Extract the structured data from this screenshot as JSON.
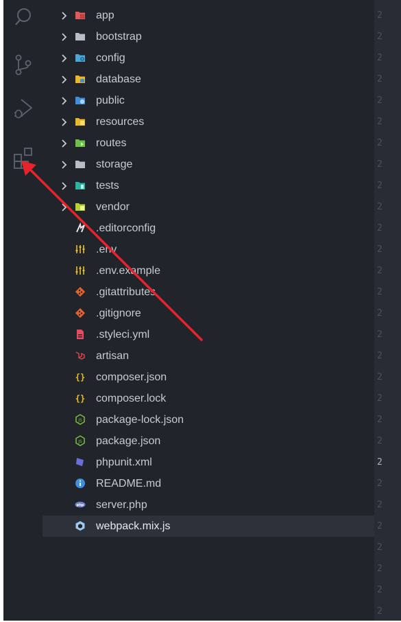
{
  "explorer": {
    "items": [
      {
        "label": "app",
        "type": "folder",
        "icon": "app-folder-icon",
        "color": "#e05a5a"
      },
      {
        "label": "bootstrap",
        "type": "folder",
        "icon": "folder-icon",
        "color": "#b8bcc4"
      },
      {
        "label": "config",
        "type": "folder",
        "icon": "config-folder-icon",
        "color": "#4aa7d8"
      },
      {
        "label": "database",
        "type": "folder",
        "icon": "database-folder-icon",
        "color": "#e9b824"
      },
      {
        "label": "public",
        "type": "folder",
        "icon": "public-folder-icon",
        "color": "#3f8fdc"
      },
      {
        "label": "resources",
        "type": "folder",
        "icon": "resources-folder-icon",
        "color": "#e9b824"
      },
      {
        "label": "routes",
        "type": "folder",
        "icon": "routes-folder-icon",
        "color": "#6cc04a"
      },
      {
        "label": "storage",
        "type": "folder",
        "icon": "folder-icon",
        "color": "#b8bcc4"
      },
      {
        "label": "tests",
        "type": "folder",
        "icon": "tests-folder-icon",
        "color": "#2bb5a0"
      },
      {
        "label": "vendor",
        "type": "folder",
        "icon": "vendor-folder-icon",
        "color": "#b7d130"
      },
      {
        "label": ".editorconfig",
        "type": "file",
        "icon": "editorconfig-icon",
        "color": "#e8e8e8"
      },
      {
        "label": ".env",
        "type": "file",
        "icon": "env-settings-icon",
        "color": "#e8c02a"
      },
      {
        "label": ".env.example",
        "type": "file",
        "icon": "env-settings-icon",
        "color": "#e8c02a"
      },
      {
        "label": ".gitattributes",
        "type": "file",
        "icon": "git-icon",
        "color": "#e4622c"
      },
      {
        "label": ".gitignore",
        "type": "file",
        "icon": "git-icon",
        "color": "#e4622c"
      },
      {
        "label": ".styleci.yml",
        "type": "file",
        "icon": "yaml-file-icon",
        "color": "#e34c60"
      },
      {
        "label": "artisan",
        "type": "file",
        "icon": "laravel-icon",
        "color": "#e3484a"
      },
      {
        "label": "composer.json",
        "type": "file",
        "icon": "json-braces-icon",
        "color": "#e8c02a"
      },
      {
        "label": "composer.lock",
        "type": "file",
        "icon": "json-braces-icon",
        "color": "#e8c02a"
      },
      {
        "label": "package-lock.json",
        "type": "file",
        "icon": "nodejs-icon",
        "color": "#7bbf3e"
      },
      {
        "label": "package.json",
        "type": "file",
        "icon": "nodejs-icon",
        "color": "#7bbf3e"
      },
      {
        "label": "phpunit.xml",
        "type": "file",
        "icon": "phpunit-icon",
        "color": "#6a6fd8"
      },
      {
        "label": "README.md",
        "type": "file",
        "icon": "info-icon",
        "color": "#3f8fdc"
      },
      {
        "label": "server.php",
        "type": "file",
        "icon": "php-icon",
        "color": "#6a7fd4"
      },
      {
        "label": "webpack.mix.js",
        "type": "file",
        "icon": "webpack-cube-icon",
        "color": "#9fc8ee",
        "selected": true
      }
    ]
  },
  "activity_bar": {
    "icons": [
      "search-icon",
      "source-control-icon",
      "run-debug-icon",
      "extensions-icon"
    ]
  },
  "editor": {
    "line_numbers": [
      "2",
      "2",
      "2",
      "2",
      "2",
      "2",
      "2",
      "2",
      "2",
      "2",
      "2",
      "2",
      "2",
      "2",
      "2",
      "2",
      "2",
      "2",
      "2",
      "2",
      "2",
      "2",
      "2",
      "2",
      "2",
      "2",
      "2",
      "2",
      "2"
    ],
    "current_line_index": 21
  },
  "annotation": {
    "arrow_color": "#e8232a"
  },
  "colors": {
    "sidebar_bg": "#21252b",
    "editor_bg": "#282c34",
    "selected_row": "#2c313a",
    "text": "#c6cbd3"
  }
}
